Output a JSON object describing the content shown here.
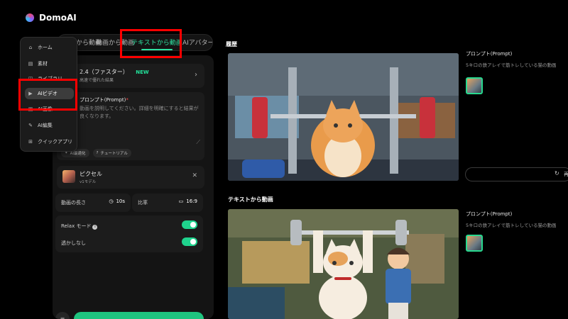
{
  "app": {
    "name": "DomoAI"
  },
  "tabs": [
    {
      "label": "画像から動画"
    },
    {
      "label": "動画から動画"
    },
    {
      "label": "テキストから動画",
      "active": true
    },
    {
      "label": "AIアバター"
    }
  ],
  "nav": {
    "items": [
      {
        "label": "ホーム",
        "icon": "home-icon"
      },
      {
        "label": "素材",
        "icon": "folder-icon"
      },
      {
        "label": "ライブラリ",
        "icon": "library-icon"
      },
      {
        "label": "AIビデオ",
        "icon": "video-icon",
        "active": true
      },
      {
        "label": "AI画像",
        "icon": "image-icon"
      },
      {
        "label": "AI編集",
        "icon": "edit-icon"
      },
      {
        "label": "クイックアプリ",
        "icon": "apps-icon"
      }
    ]
  },
  "model": {
    "title": "2.4（ファスター）",
    "badge": "NEW",
    "subtitle": "高速で優れた結果"
  },
  "prompt": {
    "label": "プロンプト(Prompt)",
    "placeholder": "動画を説明してください。詳細を明確にすると結果が良くなります。",
    "tool_optimize": "AI最適化",
    "tool_tutorial": "チュートリアル"
  },
  "style": {
    "name": "ピクセル",
    "subtitle": "v1モデル"
  },
  "options": {
    "length_label": "動画の長さ",
    "length_value": "10s",
    "ratio_label": "比率",
    "ratio_value": "16:9"
  },
  "toggles": {
    "relax_label": "Relax モード",
    "relax_on": true,
    "watermark_label": "透かしなし",
    "watermark_on": true
  },
  "history": {
    "title": "履歴",
    "prompt_label": "プロンプト(Prompt)",
    "prompt_text": "5キロの鉄アレイで筋トレしている猫の動画",
    "regen_label": "再"
  },
  "t2v": {
    "title": "テキストから動画",
    "prompt_label": "プロンプト(Prompt)",
    "prompt_text": "5キロの鉄アレイで筋トレしている猫の動画"
  },
  "colors": {
    "accent": "#22e39b",
    "highlight": "#ff0000",
    "background": "#000000"
  }
}
